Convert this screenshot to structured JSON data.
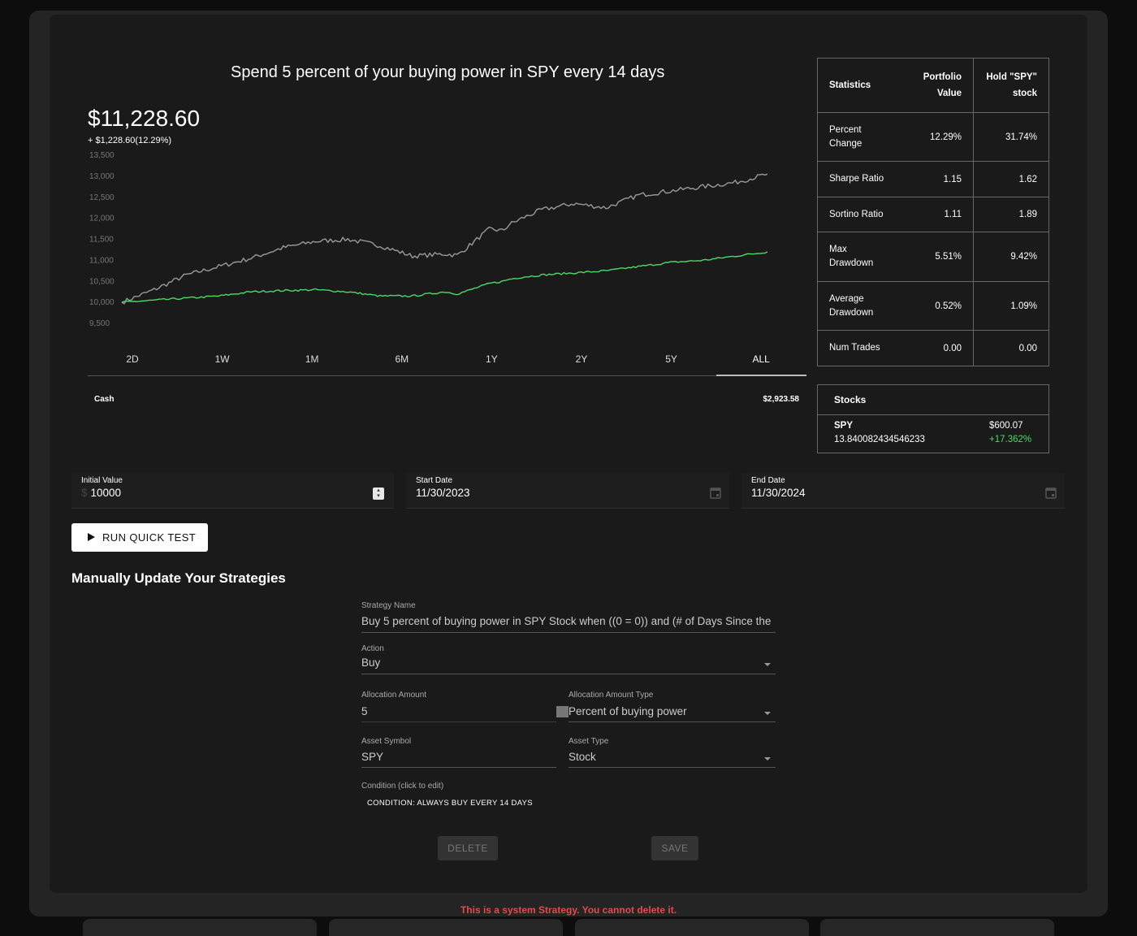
{
  "chart_header": {
    "title": "Spend 5 percent of your buying power in SPY every 14 days",
    "value": "$11,228.60",
    "change": "+ $1,228.60(12.29%)"
  },
  "time_ranges": [
    "2D",
    "1W",
    "1M",
    "6M",
    "1Y",
    "2Y",
    "5Y",
    "ALL"
  ],
  "active_range": "ALL",
  "cash": {
    "label": "Cash",
    "value": "$2,923.58"
  },
  "statistics": {
    "headers": [
      "Statistics",
      "Portfolio Value",
      "Hold \"SPY\" stock"
    ],
    "rows": [
      {
        "label": "Percent Change",
        "portfolio": "12.29%",
        "hold": "31.74%"
      },
      {
        "label": "Sharpe Ratio",
        "portfolio": "1.15",
        "hold": "1.62"
      },
      {
        "label": "Sortino Ratio",
        "portfolio": "1.11",
        "hold": "1.89"
      },
      {
        "label": "Max Drawdown",
        "portfolio": "5.51%",
        "hold": "9.42%"
      },
      {
        "label": "Average Drawdown",
        "portfolio": "0.52%",
        "hold": "1.09%"
      },
      {
        "label": "Num Trades",
        "portfolio": "0.00",
        "hold": "0.00"
      }
    ]
  },
  "stocks": {
    "header": "Stocks",
    "items": [
      {
        "symbol": "SPY",
        "quantity": "13.840082434546233",
        "price": "$600.07",
        "change": "+17.362%"
      }
    ]
  },
  "inputs": {
    "initial_value": {
      "label": "Initial Value",
      "prefix": "$",
      "value": "10000"
    },
    "start_date": {
      "label": "Start Date",
      "value": "11/30/2023"
    },
    "end_date": {
      "label": "End Date",
      "value": "11/30/2024"
    }
  },
  "run_button": "RUN QUICK TEST",
  "section_title": "Manually Update Your Strategies",
  "strategy_form": {
    "strategy_name": {
      "label": "Strategy Name",
      "value": "Buy 5 percent of buying power in SPY Stock when ((0 = 0)) and (# of Days Since the"
    },
    "action": {
      "label": "Action",
      "value": "Buy"
    },
    "allocation_amount": {
      "label": "Allocation Amount",
      "value": "5"
    },
    "allocation_type": {
      "label": "Allocation Amount Type",
      "value": "Percent of buying power"
    },
    "asset_symbol": {
      "label": "Asset Symbol",
      "value": "SPY"
    },
    "asset_type": {
      "label": "Asset Type",
      "value": "Stock"
    },
    "condition": {
      "label": "Condition (click to edit)",
      "value": "CONDITION: ALWAYS BUY EVERY 14 DAYS"
    }
  },
  "buttons": {
    "delete": "DELETE",
    "save": "SAVE"
  },
  "error_message": "This is a system Strategy. You cannot delete it.",
  "colors": {
    "portfolio_line": "#4cd964",
    "benchmark_line": "#9a9a9a",
    "error": "#e24b4b"
  },
  "chart_data": {
    "type": "line",
    "y_ticks": [
      "13,500",
      "13,000",
      "12,500",
      "12,000",
      "11,500",
      "11,000",
      "10,500",
      "10,000",
      "9,500"
    ],
    "ylim": [
      9500,
      13500
    ],
    "x": [
      0,
      5,
      10,
      15,
      20,
      25,
      30,
      35,
      40,
      45,
      50,
      52,
      55,
      57,
      59,
      60,
      62,
      65,
      70,
      75,
      80,
      85,
      90,
      95,
      100
    ],
    "series": [
      {
        "values": [
          10000,
          10300,
          10650,
          10850,
          11050,
          11300,
          11450,
          11500,
          11350,
          11100,
          11150,
          11120,
          11500,
          11750,
          11700,
          11850,
          12000,
          12200,
          12350,
          12250,
          12550,
          12650,
          12750,
          12850,
          13050
        ]
      },
      {
        "values": [
          10000,
          10050,
          10100,
          10150,
          10250,
          10280,
          10300,
          10250,
          10150,
          10150,
          10250,
          10200,
          10350,
          10450,
          10500,
          10550,
          10600,
          10650,
          10700,
          10750,
          10850,
          10950,
          11000,
          11100,
          11200
        ]
      }
    ]
  }
}
